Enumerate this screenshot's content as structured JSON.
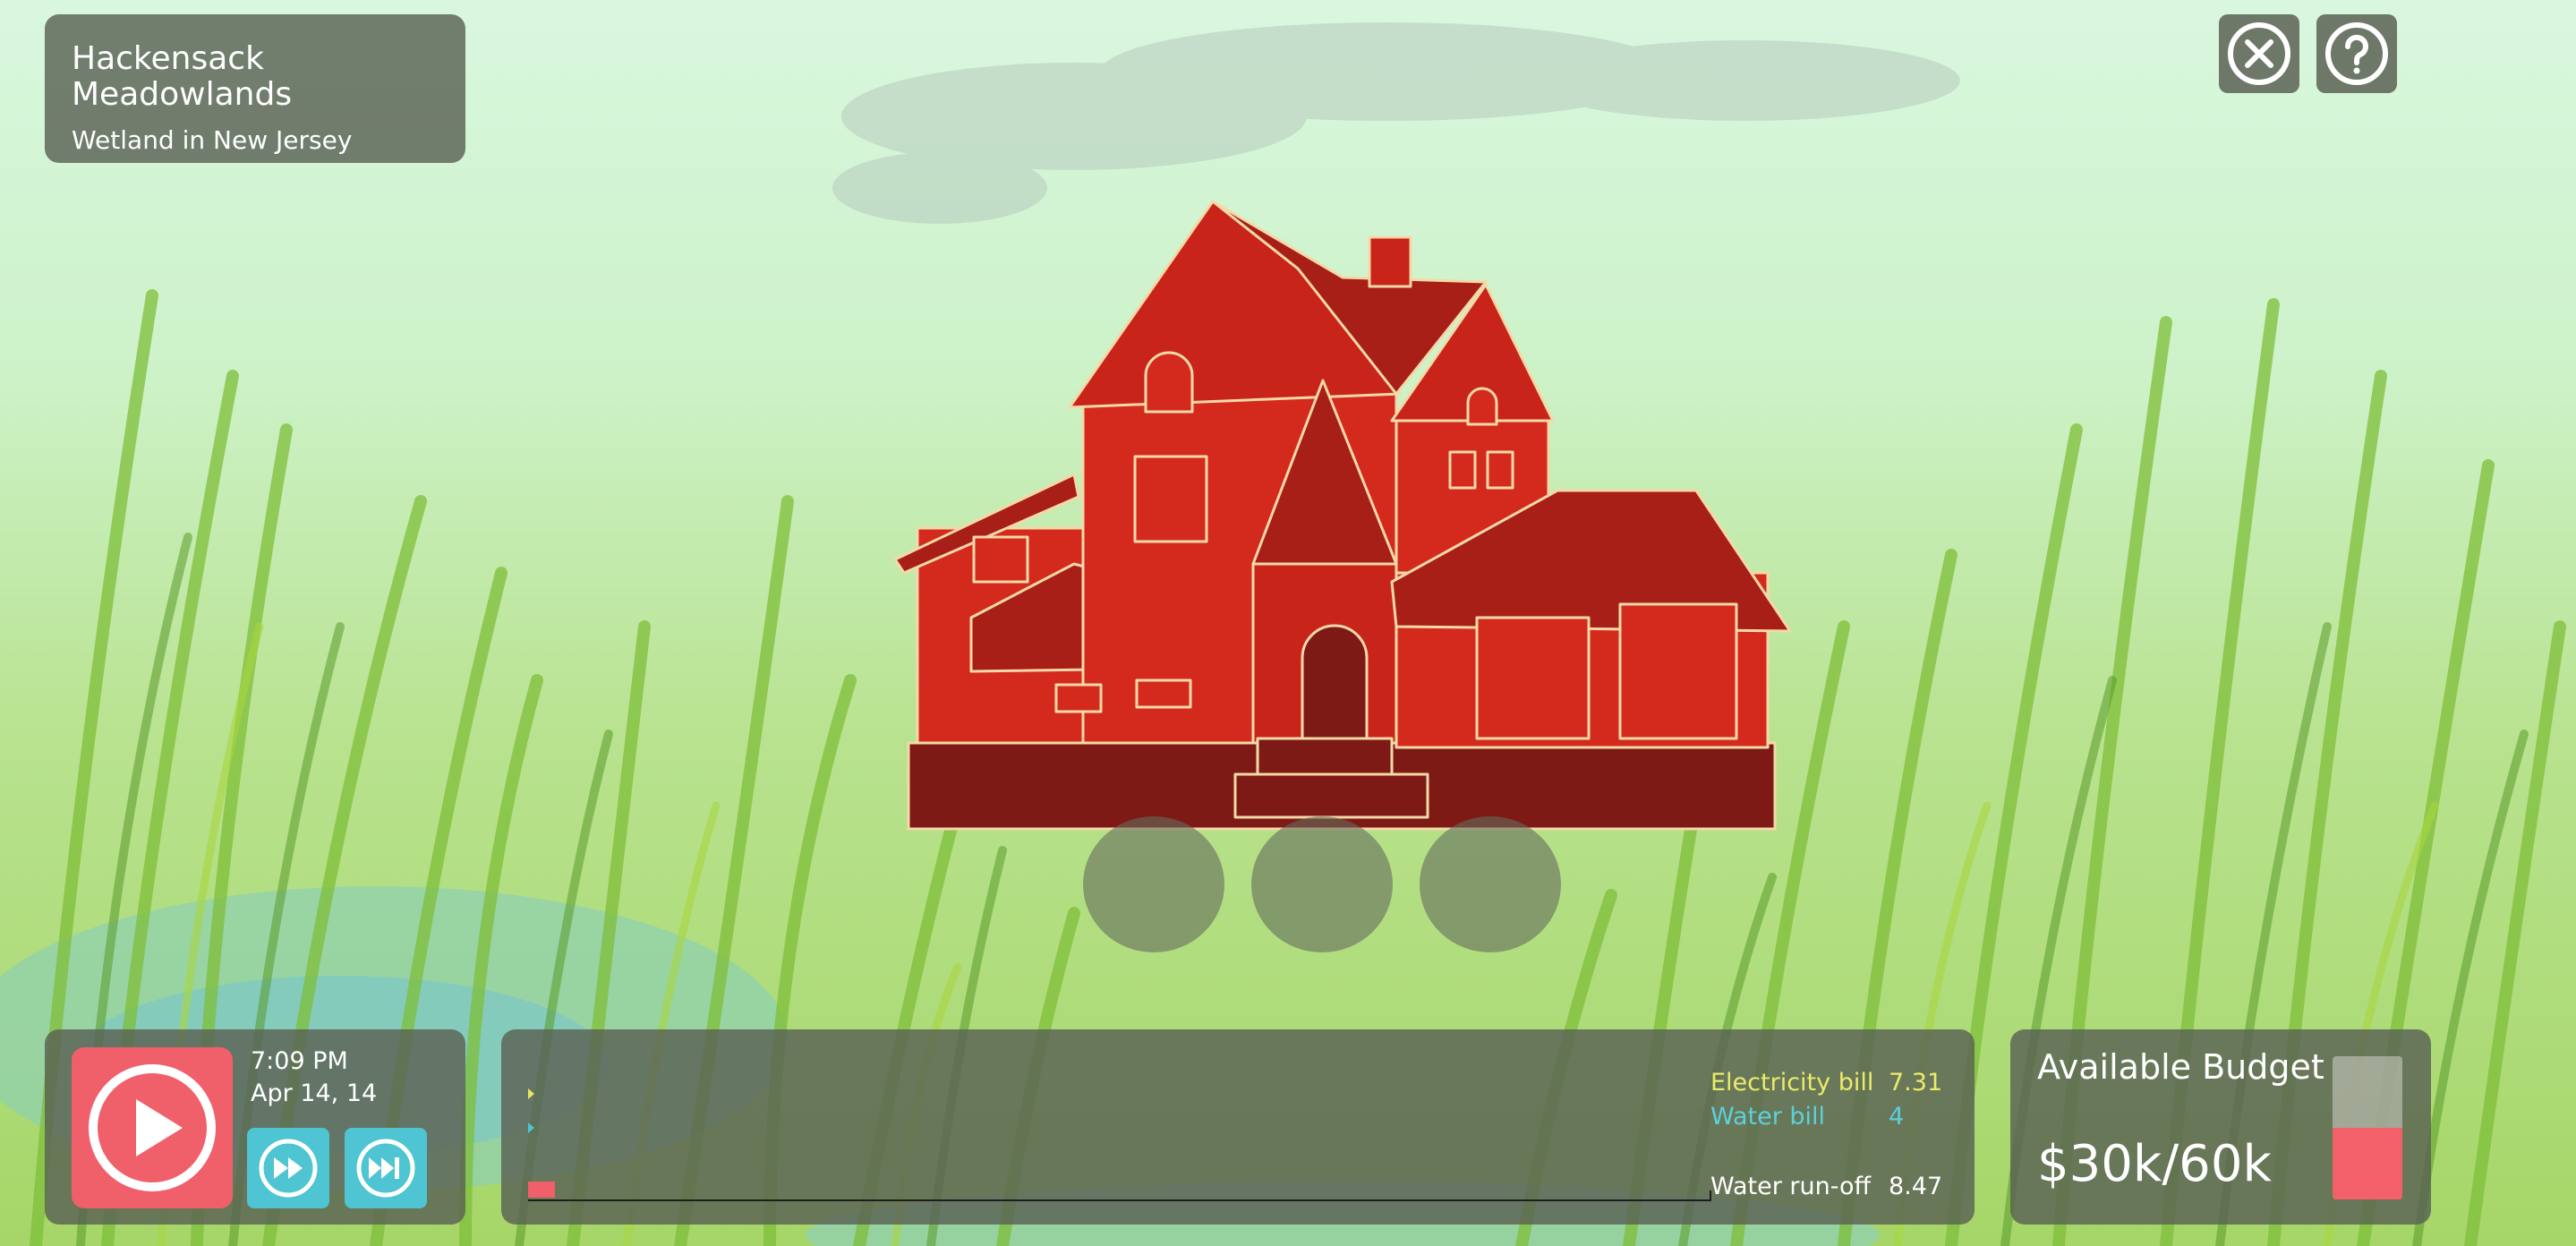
{
  "location": {
    "name": "Hackensack Meadowlands",
    "description": "Wetland in New Jersey"
  },
  "controls": {
    "close_icon": "close-icon",
    "help_icon": "help-icon",
    "play_icon": "play-icon",
    "fast_forward_icon": "fast-forward-icon",
    "skip_forward_icon": "skip-forward-icon"
  },
  "clock": {
    "time": "7:09 PM",
    "date": "Apr 14, 14"
  },
  "metrics": {
    "electricity_label": "Electricity bill",
    "electricity_value": "7.31",
    "water_label": "Water bill",
    "water_value": "4",
    "runoff_label": "Water run-off",
    "runoff_value": "8.47"
  },
  "budget": {
    "title": "Available Budget",
    "value": "$30k/60k",
    "fraction": 0.5
  },
  "colors": {
    "accent_red": "#f0606a",
    "accent_cyan": "#4fc4d2",
    "electricity_yellow": "#eaec6a",
    "house_red": "#d42a1e",
    "house_dark": "#7e1a16"
  }
}
